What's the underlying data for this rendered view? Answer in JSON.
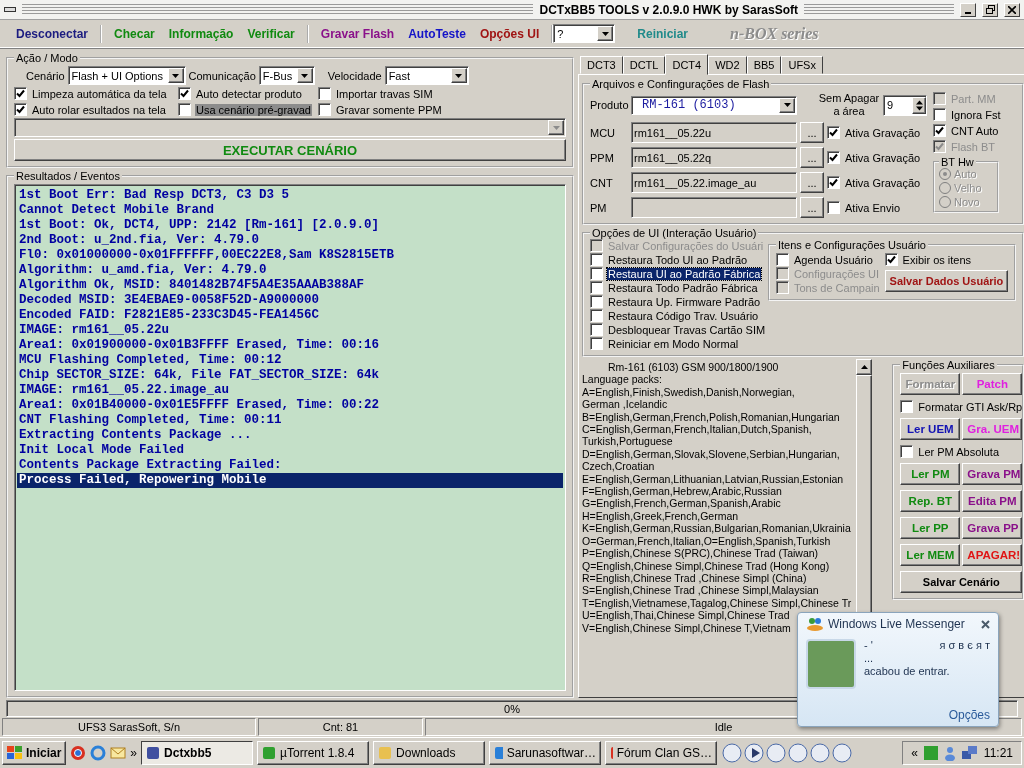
{
  "window": {
    "title": "DCTxBB5 TOOLS v 2.0.9.0 HWK by SarasSoft"
  },
  "toolbar": [
    [
      {
        "label": "Desconectar",
        "color": "#1c1c80"
      }
    ],
    [
      {
        "label": "Checar",
        "color": "#108a10"
      },
      {
        "label": "Informação",
        "color": "#108a10"
      },
      {
        "label": "Verificar",
        "color": "#108a10"
      }
    ],
    [
      {
        "label": "Gravar Flash",
        "color": "#8a108a"
      },
      {
        "label": "AutoTeste",
        "color": "#1414c8"
      },
      {
        "label": "Opções UI",
        "color": "#a01414"
      }
    ]
  ],
  "mode_select": {
    "value": "?"
  },
  "restart_button": "Reiniciar",
  "logo": "n-BOX series",
  "action_mode": {
    "title": "Ação / Modo",
    "fields": [
      {
        "label": "Cenário",
        "value": "Flash + UI Options"
      },
      {
        "label": "Comunicação",
        "value": "F-Bus"
      },
      {
        "label": "Velocidade",
        "value": "Fast"
      }
    ],
    "options": [
      {
        "label": "Limpeza automática da tela",
        "checked": true,
        "focused": false
      },
      {
        "label": "Auto detectar produto",
        "checked": true,
        "focused": false
      },
      {
        "label": "Importar travas SIM",
        "checked": false,
        "focused": false
      },
      {
        "label": "Auto rolar esultados na tela",
        "checked": true,
        "focused": false
      },
      {
        "label": "Usa cenário pré-gravad",
        "checked": false,
        "focused": true
      },
      {
        "label": "Gravar somente PPM",
        "checked": false,
        "focused": false
      }
    ],
    "run_button": "EXECUTAR CENÁRIO"
  },
  "results": {
    "title": "Resultados / Eventos",
    "lines": [
      {
        "text": "1st Boot Err: Bad Resp DCT3, C3 D3 5",
        "selected": false
      },
      {
        "text": "Cannot Detect Mobile Brand",
        "selected": false
      },
      {
        "text": "1st Boot: Ok, DCT4, UPP: 2142 [Rm-161] [2.0.9.0]",
        "selected": false
      },
      {
        "text": "2nd Boot: u_2nd.fia, Ver: 4.79.0",
        "selected": false
      },
      {
        "text": "Fl0: 0x01000000-0x01FFFFFF,00EC22E8,Sam K8S2815ETB",
        "selected": false
      },
      {
        "text": "Algorithm: u_amd.fia, Ver: 4.79.0",
        "selected": false
      },
      {
        "text": "Algorithm Ok, MSID: 8401482B74F5A4E35AAAB388AF",
        "selected": false
      },
      {
        "text": "Decoded MSID: 3E4EBAE9-0058F52D-A9000000",
        "selected": false
      },
      {
        "text": "Encoded FAID: F2821E85-233C3D45-FEA1456C",
        "selected": false
      },
      {
        "text": "IMAGE: rm161__05.22u",
        "selected": false
      },
      {
        "text": "Area1: 0x01900000-0x01B3FFFF Erased, Time: 00:16",
        "selected": false
      },
      {
        "text": "MCU Flashing Completed, Time: 00:12",
        "selected": false
      },
      {
        "text": "Chip SECTOR_SIZE: 64k, File FAT_SECTOR_SIZE: 64k",
        "selected": false
      },
      {
        "text": "IMAGE: rm161__05.22.image_au",
        "selected": false
      },
      {
        "text": "Area1: 0x01B40000-0x01E5FFFF Erased, Time: 00:22",
        "selected": false
      },
      {
        "text": "CNT Flashing Completed, Time: 00:11",
        "selected": false
      },
      {
        "text": "Extracting Contents Package ...",
        "selected": false
      },
      {
        "text": "Init Local Mode Failed",
        "selected": false
      },
      {
        "text": "Contents Package Extracting Failed:",
        "selected": false
      },
      {
        "text": "Process Failed, Repowering Mobile",
        "selected": true
      }
    ]
  },
  "tabs": [
    {
      "label": "DCT3",
      "selected": false
    },
    {
      "label": "DCTL",
      "selected": false
    },
    {
      "label": "DCT4",
      "selected": true
    },
    {
      "label": "WD2",
      "selected": false
    },
    {
      "label": "BB5",
      "selected": false
    },
    {
      "label": "UFSx",
      "selected": false
    }
  ],
  "flash": {
    "title": "Arquivos e Confingurações de Flash",
    "product_label": "Produto",
    "product": "RM-161 (6103)",
    "erase_label": "Sem Apagar a área",
    "erase_value": "9",
    "files": [
      {
        "label": "MCU",
        "value": "rm161__05.22u",
        "browse": "...",
        "option": "Ativa Gravação",
        "checked": true
      },
      {
        "label": "PPM",
        "value": "rm161__05.22q",
        "browse": "...",
        "option": "Ativa Gravação",
        "checked": true
      },
      {
        "label": "CNT",
        "value": "rm161__05.22.image_au",
        "browse": "...",
        "option": "Ativa Gravação",
        "checked": true
      },
      {
        "label": "PM",
        "browse": "...",
        "option": "Ativa Envio",
        "checked": false
      }
    ],
    "flags": [
      {
        "label": "Part. MM",
        "checked": false,
        "disabled": true
      },
      {
        "label": "Ignora Fst",
        "checked": false,
        "disabled": false
      },
      {
        "label": "CNT Auto",
        "checked": true,
        "disabled": false
      },
      {
        "label": "Flash BT",
        "checked": true,
        "disabled": true
      }
    ],
    "bt_hw": {
      "title": "BT Hw",
      "disabled": true,
      "options": [
        {
          "label": "Auto",
          "selected": true
        },
        {
          "label": "Velho",
          "selected": false
        },
        {
          "label": "Novo",
          "selected": false
        }
      ]
    }
  },
  "ui_options": {
    "title": "Opções de UI (Interação Usuário)",
    "items": [
      {
        "label": "Salvar Configurações do Usuári",
        "checked": false,
        "disabled": true,
        "focused": false
      },
      {
        "label": "Restaura Todo UI ao Padrão",
        "checked": false,
        "disabled": false,
        "focused": false
      },
      {
        "label": "Restaura UI ao Padrão Fábrica",
        "checked": false,
        "disabled": false,
        "focused": true
      },
      {
        "label": "Restaura Todo Padrão Fábrica",
        "checked": false,
        "disabled": false,
        "focused": false
      },
      {
        "label": "Restaura Up. Firmware Padrão",
        "checked": false,
        "disabled": false,
        "focused": false
      },
      {
        "label": "Restaura Código Trav. Usuário",
        "checked": false,
        "disabled": false,
        "focused": false
      },
      {
        "label": "Desbloquear Travas Cartão SIM",
        "checked": false,
        "disabled": false,
        "focused": false
      },
      {
        "label": "Reiniciar em Modo Normal",
        "checked": false,
        "disabled": false,
        "focused": false
      }
    ],
    "user_items": {
      "title": "Itens e Configurações Usuário",
      "options": [
        {
          "label": "Agenda Usuário",
          "checked": false,
          "disabled": false
        },
        {
          "label": "Configurações UI",
          "checked": false,
          "disabled": true
        },
        {
          "label": "Tons de Campain",
          "checked": false,
          "disabled": true
        }
      ],
      "show_items": {
        "label": "Exibir os itens",
        "checked": true
      },
      "save_button": "Salvar Dados Usuário"
    }
  },
  "info_text": {
    "lines": [
      "Rm-161 (6103) GSM 900/1800/1900",
      "Language packs:",
      "A=English,Finish,Swedish,Danish,Norwegian,",
      "German ,Icelandic",
      "B=English,German,French,Polish,Romanian,Hungarian",
      "C=English,German,French,Italian,Dutch,Spanish,",
      "Turkish,Portuguese",
      "D=English,German,Slovak,Slovene,Serbian,Hungarian,",
      "Czech,Croatian",
      "E=English,German,Lithuanian,Latvian,Russian,Estonian",
      "F=English,German,Hebrew,Arabic,Russian",
      "G=English,French,German,Spanish,Arabic",
      "H=English,Greek,French,German",
      "K=English,German,Russian,Bulgarian,Romanian,Ukrainia",
      "O=German,French,Italian,O=English,Spanish,Turkish",
      "P=English,Chinese S(PRC),Chinese Trad (Taiwan)",
      "Q=English,Chinese Simpl,Chinese Trad (Hong Kong)",
      "R=English,Chinese Trad ,Chinese Simpl (China)",
      "S=English,Chinese Trad ,Chinese Simpl,Malaysian",
      "T=English,Vietnamese,Tagalog,Chinese Simpl,Chinese Tr",
      "U=English,Thai,Chinese Simpl,Chinese Trad",
      "V=English,Chinese Simpl,Chinese T,Vietnam"
    ]
  },
  "aux": {
    "title": "Funções Auxiliares",
    "items": [
      {
        "kind": "button",
        "label": "Formatar",
        "color": "#8c8c8c",
        "disabled": true
      },
      {
        "kind": "button",
        "label": "Patch",
        "color": "#e020e0",
        "disabled": false
      },
      {
        "kind": "checkbox",
        "label": "Formatar GTI Ask/Rp",
        "checked": false
      },
      {
        "kind": "button",
        "label": "Ler UEM",
        "color": "#1414b4",
        "disabled": false
      },
      {
        "kind": "button",
        "label": "Gra. UEM",
        "color": "#e020e0",
        "disabled": false
      },
      {
        "kind": "checkbox",
        "label": "Ler PM Absoluta",
        "checked": false
      },
      {
        "kind": "button",
        "label": "Ler PM",
        "color": "#108a10",
        "disabled": false
      },
      {
        "kind": "button",
        "label": "Grava PM",
        "color": "#8a108a",
        "disabled": false
      },
      {
        "kind": "button",
        "label": "Rep. BT",
        "color": "#108a10",
        "disabled": false
      },
      {
        "kind": "button",
        "label": "Edita PM",
        "color": "#8a108a",
        "disabled": false
      },
      {
        "kind": "button",
        "label": "Ler PP",
        "color": "#108a10",
        "disabled": false
      },
      {
        "kind": "button",
        "label": "Grava PP",
        "color": "#8a108a",
        "disabled": false
      },
      {
        "kind": "button",
        "label": "Ler MEM",
        "color": "#108a10",
        "disabled": false
      },
      {
        "kind": "button",
        "label": "APAGAR!",
        "color": "#e01414",
        "disabled": false
      },
      {
        "kind": "wide_button",
        "label": "Salvar Cenário",
        "color": "#000000",
        "disabled": false
      }
    ]
  },
  "progress": {
    "text": "0%",
    "level": 0
  },
  "status_bar": [
    "UFS3 SarasSoft, S/n",
    "Cnt: 81",
    "Idle"
  ],
  "taskbar": {
    "start": "Iniciar",
    "more": "»",
    "tasks": [
      {
        "label": "Dctxbb5",
        "selected": true
      },
      {
        "label": "µTorrent 1.8.4",
        "selected": false
      },
      {
        "label": "Downloads",
        "selected": false
      },
      {
        "label": "Sarunasoftwar…",
        "selected": false
      },
      {
        "label": "Fórum Clan GS…",
        "selected": false
      }
    ],
    "tray_toggle": "«",
    "clock": "11:21"
  },
  "messenger": {
    "title": "Windows Live Messenger",
    "name_prefix": "- '",
    "name": "я σ в є я т",
    "status": "...",
    "message": "acabou de entrar.",
    "link": "Opções"
  }
}
